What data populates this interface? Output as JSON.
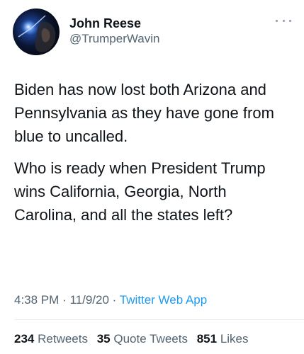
{
  "author": {
    "display_name": "John Reese",
    "handle": "@TrumperWavin"
  },
  "more_icon": "more-horizontal-icon",
  "tweet": {
    "paragraphs": [
      "Biden has now lost both Arizona and Pennsylvania as they have gone from blue to uncalled.",
      "Who is ready when President Trump wins California, Georgia, North Carolina, and all the states left?"
    ],
    "time": "4:38 PM",
    "date": "11/9/20",
    "separator": "·",
    "source": "Twitter Web App"
  },
  "stats": {
    "retweets_count": "234",
    "retweets_label": "Retweets",
    "quotes_count": "35",
    "quotes_label": "Quote Tweets",
    "likes_count": "851",
    "likes_label": "Likes"
  },
  "colors": {
    "link": "#1d9bf0",
    "secondary_text": "#536471",
    "primary_text": "#0f1419"
  }
}
